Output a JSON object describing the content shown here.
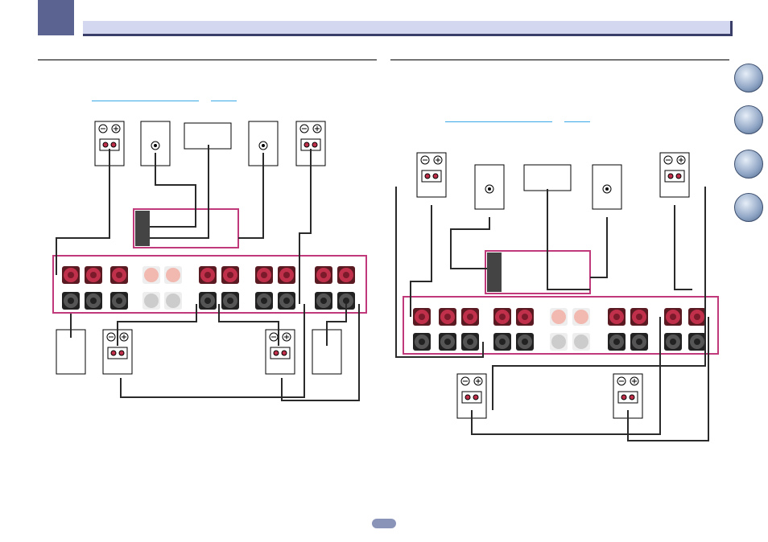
{
  "nav_icons": [
    "book-icon",
    "remote-icon",
    "question-icon",
    "tools-icon"
  ],
  "colors": {
    "header_bar": "#d3d8f0",
    "chapter_tab": "#5b6391",
    "highlight_box": "#c0397b",
    "link": "#3aa7e6",
    "terminal_red": "#c0304a",
    "terminal_black": "#3a3a3a",
    "cable": "#2a2a2a"
  }
}
